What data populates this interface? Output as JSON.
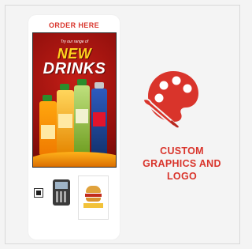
{
  "kiosk": {
    "header": "ORDER HERE",
    "screen": {
      "tagline": "Try our range of",
      "headline_line1": "NEW",
      "headline_line2": "DRINKS"
    }
  },
  "feature": {
    "icon": "palette-brush-icon",
    "caption_lines": [
      "CUSTOM",
      "GRAPHICS AND",
      "LOGO"
    ]
  },
  "colors": {
    "accent": "#d9342b",
    "background": "#f4f4f4"
  }
}
